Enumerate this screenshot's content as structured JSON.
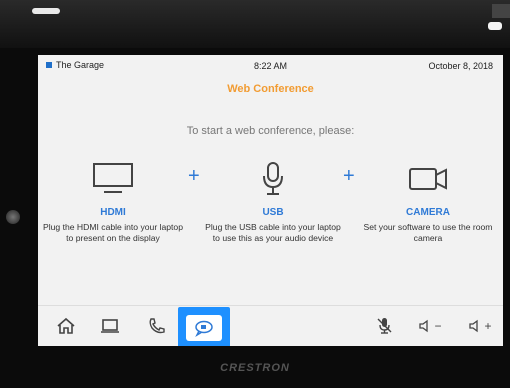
{
  "device": {
    "brand": "CRESTRON"
  },
  "status_bar": {
    "room_name": "The Garage",
    "time": "8:22 AM",
    "date": "October 8, 2018"
  },
  "page": {
    "title": "Web Conference",
    "instruction": "To start a web conference, please:"
  },
  "options": [
    {
      "label": "HDMI",
      "description": "Plug the HDMI cable into your laptop to present on the display",
      "icon": "monitor-icon"
    },
    {
      "label": "USB",
      "description": "Plug the USB cable into your laptop to use this as your audio device",
      "icon": "microphone-icon"
    },
    {
      "label": "CAMERA",
      "description": "Set your software to use the room camera",
      "icon": "camera-icon"
    }
  ],
  "plus_sign": "+",
  "toolbar": {
    "items": [
      {
        "name": "home",
        "icon": "home-icon"
      },
      {
        "name": "laptop",
        "icon": "laptop-icon"
      },
      {
        "name": "phone",
        "icon": "phone-icon"
      },
      {
        "name": "web-conference",
        "icon": "chat-bubble-icon",
        "selected": true
      },
      {
        "name": "mic-mute",
        "icon": "microphone-mute-icon"
      },
      {
        "name": "volume-down",
        "icon": "volume-down-icon",
        "text": "−"
      },
      {
        "name": "volume-up",
        "icon": "volume-up-icon",
        "text": "+"
      }
    ],
    "accent": "#1e90ff"
  },
  "colors": {
    "title": "#f29c33",
    "option_label": "#2f7ad6",
    "screen_bg": "#f2f2f2"
  }
}
